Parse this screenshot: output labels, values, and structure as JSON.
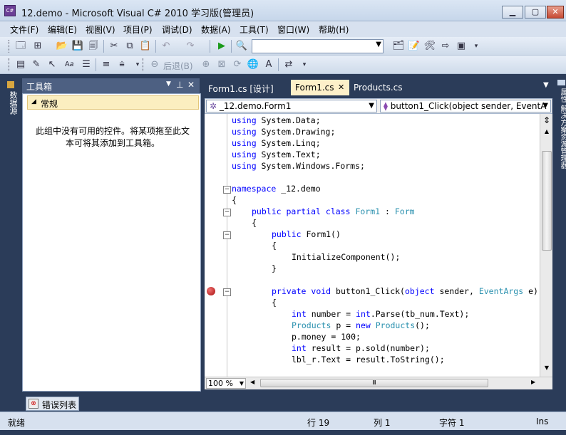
{
  "window": {
    "title": "12.demo - Microsoft Visual C# 2010 学习版(管理员)"
  },
  "menu": [
    "文件(F)",
    "编辑(E)",
    "视图(V)",
    "项目(P)",
    "调试(D)",
    "数据(A)",
    "工具(T)",
    "窗口(W)",
    "帮助(H)"
  ],
  "toolbar2": {
    "back_label": "后退(B)"
  },
  "left_sidebar": {
    "tab_label": "数据源"
  },
  "toolbox": {
    "title": "工具箱",
    "group_label": "常规",
    "empty_message": "此组中没有可用的控件。将某项拖至此文本可将其添加到工具箱。"
  },
  "tabs": [
    {
      "label": "Form1.cs [设计]",
      "active": false
    },
    {
      "label": "Form1.cs",
      "active": true
    },
    {
      "label": "Products.cs",
      "active": false
    }
  ],
  "nav": {
    "class_selector": "_12.demo.Form1",
    "member_selector": "button1_Click(object sender, EventA"
  },
  "code_lines": [
    {
      "indent": 0,
      "tokens": [
        [
          "kw",
          "using"
        ],
        [
          "t",
          " System.Data;"
        ]
      ]
    },
    {
      "indent": 0,
      "tokens": [
        [
          "kw",
          "using"
        ],
        [
          "t",
          " System.Drawing;"
        ]
      ]
    },
    {
      "indent": 0,
      "tokens": [
        [
          "kw",
          "using"
        ],
        [
          "t",
          " System.Linq;"
        ]
      ]
    },
    {
      "indent": 0,
      "tokens": [
        [
          "kw",
          "using"
        ],
        [
          "t",
          " System.Text;"
        ]
      ]
    },
    {
      "indent": 0,
      "tokens": [
        [
          "kw",
          "using"
        ],
        [
          "t",
          " System.Windows.Forms;"
        ]
      ]
    },
    {
      "indent": 0,
      "tokens": []
    },
    {
      "indent": 0,
      "tokens": [
        [
          "kw",
          "namespace"
        ],
        [
          "t",
          " _12.demo"
        ]
      ]
    },
    {
      "indent": 0,
      "tokens": [
        [
          "t",
          "{"
        ]
      ]
    },
    {
      "indent": 1,
      "tokens": [
        [
          "kw",
          "public"
        ],
        [
          "t",
          " "
        ],
        [
          "kw",
          "partial"
        ],
        [
          "t",
          " "
        ],
        [
          "kw",
          "class"
        ],
        [
          "t",
          " "
        ],
        [
          "ty",
          "Form1"
        ],
        [
          "t",
          " : "
        ],
        [
          "ty",
          "Form"
        ]
      ]
    },
    {
      "indent": 1,
      "tokens": [
        [
          "t",
          "{"
        ]
      ]
    },
    {
      "indent": 2,
      "tokens": [
        [
          "kw",
          "public"
        ],
        [
          "t",
          " Form1()"
        ]
      ]
    },
    {
      "indent": 2,
      "tokens": [
        [
          "t",
          "{"
        ]
      ]
    },
    {
      "indent": 3,
      "tokens": [
        [
          "t",
          "InitializeComponent();"
        ]
      ]
    },
    {
      "indent": 2,
      "tokens": [
        [
          "t",
          "}"
        ]
      ]
    },
    {
      "indent": 0,
      "tokens": []
    },
    {
      "indent": 2,
      "tokens": [
        [
          "kw",
          "private"
        ],
        [
          "t",
          " "
        ],
        [
          "kw",
          "void"
        ],
        [
          "t",
          " button1_Click("
        ],
        [
          "kw",
          "object"
        ],
        [
          "t",
          " sender, "
        ],
        [
          "ty",
          "EventArgs"
        ],
        [
          "t",
          " e)"
        ]
      ]
    },
    {
      "indent": 2,
      "tokens": [
        [
          "t",
          "{"
        ]
      ]
    },
    {
      "indent": 3,
      "tokens": [
        [
          "kw",
          "int"
        ],
        [
          "t",
          " number = "
        ],
        [
          "kw",
          "int"
        ],
        [
          "t",
          ".Parse(tb_num.Text);"
        ]
      ]
    },
    {
      "indent": 3,
      "tokens": [
        [
          "ty",
          "Products"
        ],
        [
          "t",
          " p = "
        ],
        [
          "kw",
          "new"
        ],
        [
          "t",
          " "
        ],
        [
          "ty",
          "Products"
        ],
        [
          "t",
          "();"
        ]
      ]
    },
    {
      "indent": 3,
      "tokens": [
        [
          "t",
          "p.money = 100;"
        ]
      ]
    },
    {
      "indent": 3,
      "tokens": [
        [
          "kw",
          "int"
        ],
        [
          "t",
          " result = p.sold(number);"
        ]
      ]
    },
    {
      "indent": 3,
      "tokens": [
        [
          "t",
          "lbl_r.Text = result.ToString();"
        ]
      ]
    }
  ],
  "zoom": "100 %",
  "error_list_label": "错误列表",
  "status": {
    "ready": "就绪",
    "line": "行 19",
    "col": "列 1",
    "char": "字符 1",
    "mode": "Ins"
  },
  "right_sidebar": {
    "tab_label": "属性  解决方案资源管理器"
  },
  "colors": {
    "keyword": "#0000ff",
    "type": "#2b91af",
    "active_tab": "#fdf0c9",
    "chrome": "#2b3c59"
  }
}
